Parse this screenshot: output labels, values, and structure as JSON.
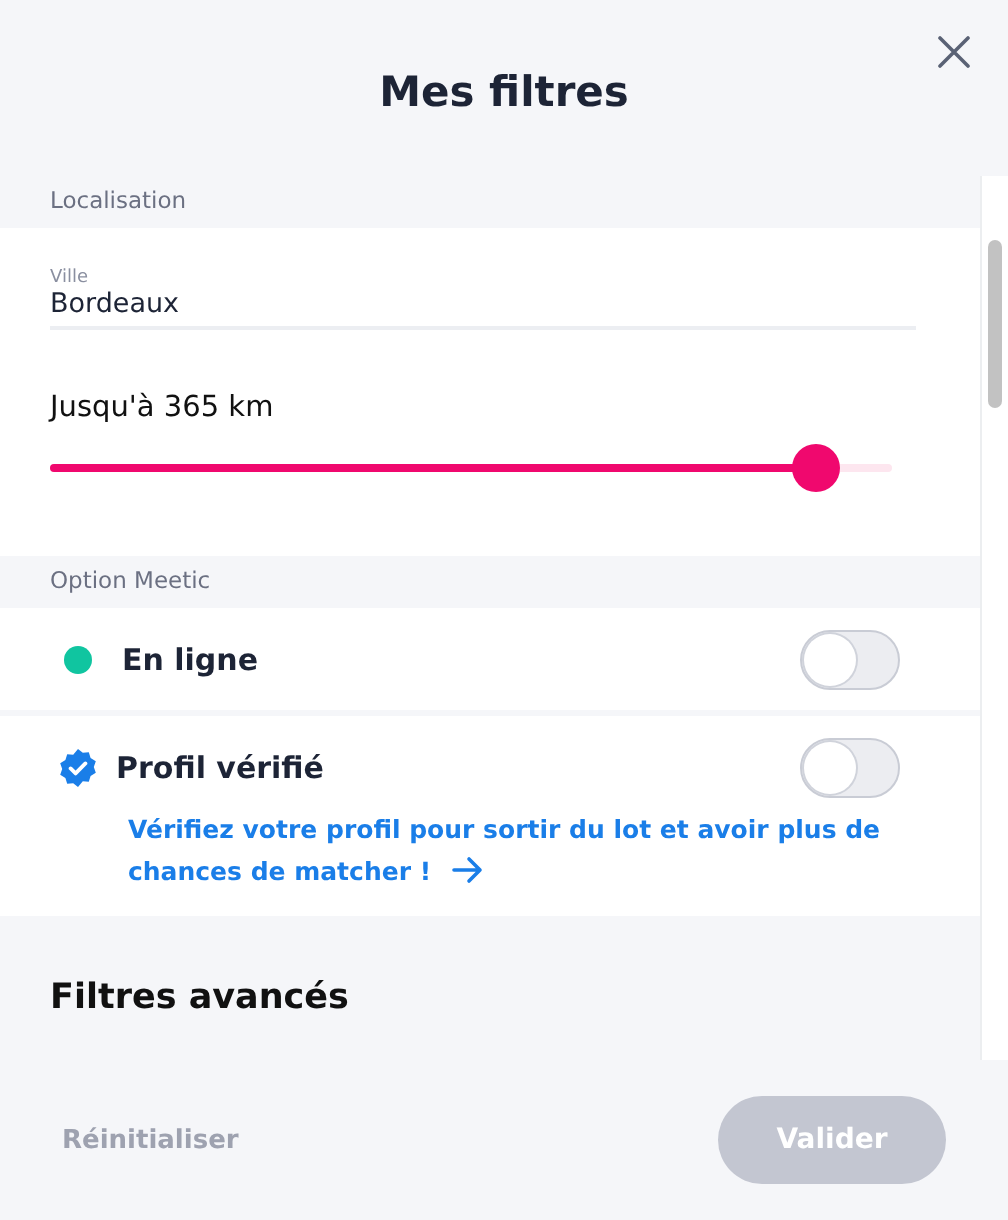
{
  "title": "Mes filtres",
  "location": {
    "header": "Localisation",
    "city_label": "Ville",
    "city": "Bordeaux",
    "distance": "Jusqu'à 365 km",
    "level": 0.91
  },
  "options": {
    "header": "Option Meetic",
    "items": [
      {
        "kind": "dot",
        "label": "En ligne",
        "on": false,
        "color": "#10c5a0"
      },
      {
        "kind": "verified",
        "label": "Profil vérifié",
        "on": false,
        "link": "Vérifiez votre profil pour sortir du lot et avoir plus de chances de matcher !"
      }
    ]
  },
  "advanced": {
    "title": "Filtres avancés"
  },
  "footer": {
    "reset": {
      "label": "Réinitialiser",
      "disabled": true
    },
    "submit": {
      "label": "Valider",
      "disabled": true
    }
  }
}
